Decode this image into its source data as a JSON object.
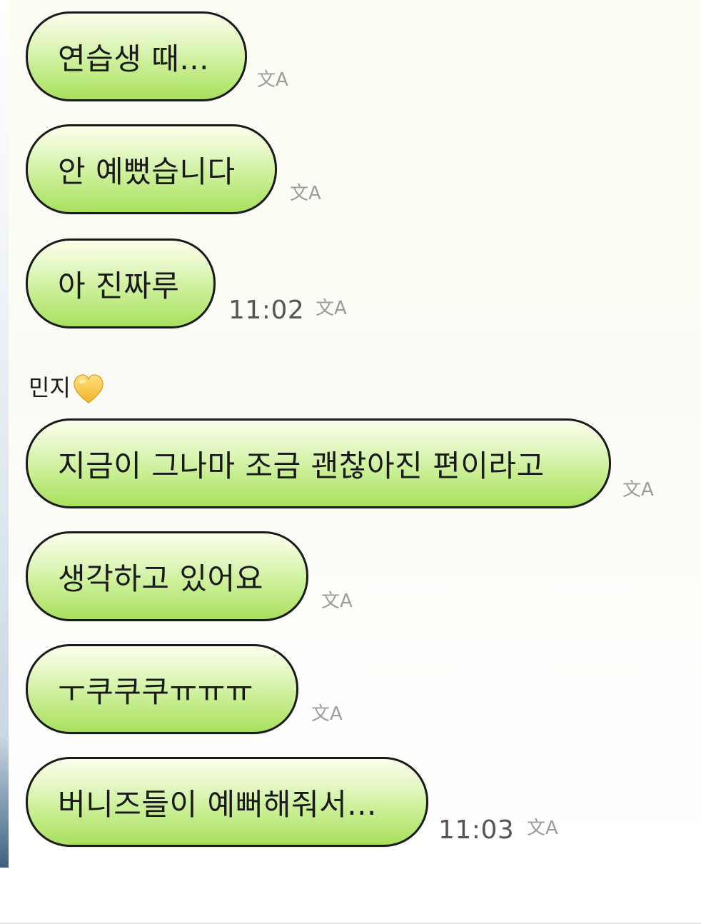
{
  "chat": {
    "messages_group1": [
      {
        "text": "연습생 때..."
      },
      {
        "text": "안 예뻤습니다"
      },
      {
        "text": "아 진짜루"
      }
    ],
    "group1_time": "11:02",
    "sender_name": "민지",
    "sender_emoji_icon": "yellow-heart-icon",
    "messages_group2": [
      {
        "text": "지금이 그나마 조금 괜찮아진 편이라고"
      },
      {
        "text": "생각하고 있어요"
      },
      {
        "text": "ㅜ쿠쿠쿠ㅠㅠㅠ"
      },
      {
        "text": "버니즈들이 예뻐해줘서..."
      }
    ],
    "group2_time": "11:03",
    "translate_icon_label": "文A"
  },
  "colors": {
    "bubble_green": "#a9e05e",
    "bubble_border": "#1a1a1a",
    "heart_yellow": "#f6c544"
  }
}
